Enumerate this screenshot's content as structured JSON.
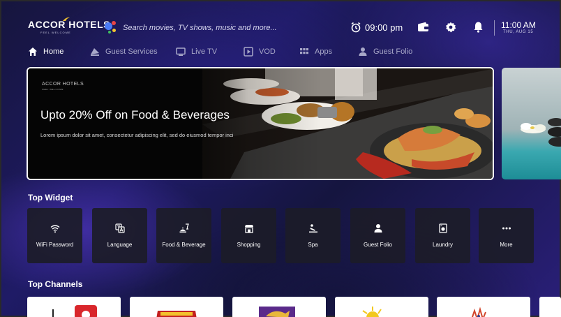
{
  "header": {
    "logo_text": "ACCOR HOTELS",
    "logo_subtext": "FEEL WELCOME",
    "search_placeholder": "Search movies, TV shows, music and more...",
    "alarm_time": "09:00 pm",
    "time": "11:00 AM",
    "date": "THU, AUG 15"
  },
  "nav": [
    {
      "label": "Home",
      "icon": "home-icon",
      "active": true
    },
    {
      "label": "Guest Services",
      "icon": "guest-services-icon",
      "active": false
    },
    {
      "label": "Live TV",
      "icon": "tv-icon",
      "active": false
    },
    {
      "label": "VOD",
      "icon": "play-icon",
      "active": false
    },
    {
      "label": "Apps",
      "icon": "apps-grid-icon",
      "active": false
    },
    {
      "label": "Guest Folio",
      "icon": "person-icon",
      "active": false
    }
  ],
  "banner": {
    "logo_text": "ACCOR HOTELS",
    "logo_subtext": "FEEL WELCOME",
    "title": "Upto 20% Off on Food & Beverages",
    "description": "Lorem ipsum dolor sit amet, consectetur adipiscing elit, sed do eiusmod tempor inci"
  },
  "sections": {
    "top_widget": "Top Widget",
    "top_channels": "Top Channels"
  },
  "widgets": [
    {
      "label": "WiFi Password",
      "icon": "wifi-icon"
    },
    {
      "label": "Language",
      "icon": "language-icon"
    },
    {
      "label": "Food & Beverage",
      "icon": "food-beverage-icon"
    },
    {
      "label": "Shopping",
      "icon": "shopping-icon"
    },
    {
      "label": "Spa",
      "icon": "spa-icon"
    },
    {
      "label": "Guest Folio",
      "icon": "person-icon"
    },
    {
      "label": "Laundry",
      "icon": "washing-machine-icon"
    },
    {
      "label": "More",
      "icon": "more-dots-icon"
    }
  ],
  "colors": {
    "brand_accent": "#f2c230",
    "active_nav": "#ffffff",
    "inactive_nav": "#a8a8c8",
    "widget_bg": "#1c1c28"
  }
}
